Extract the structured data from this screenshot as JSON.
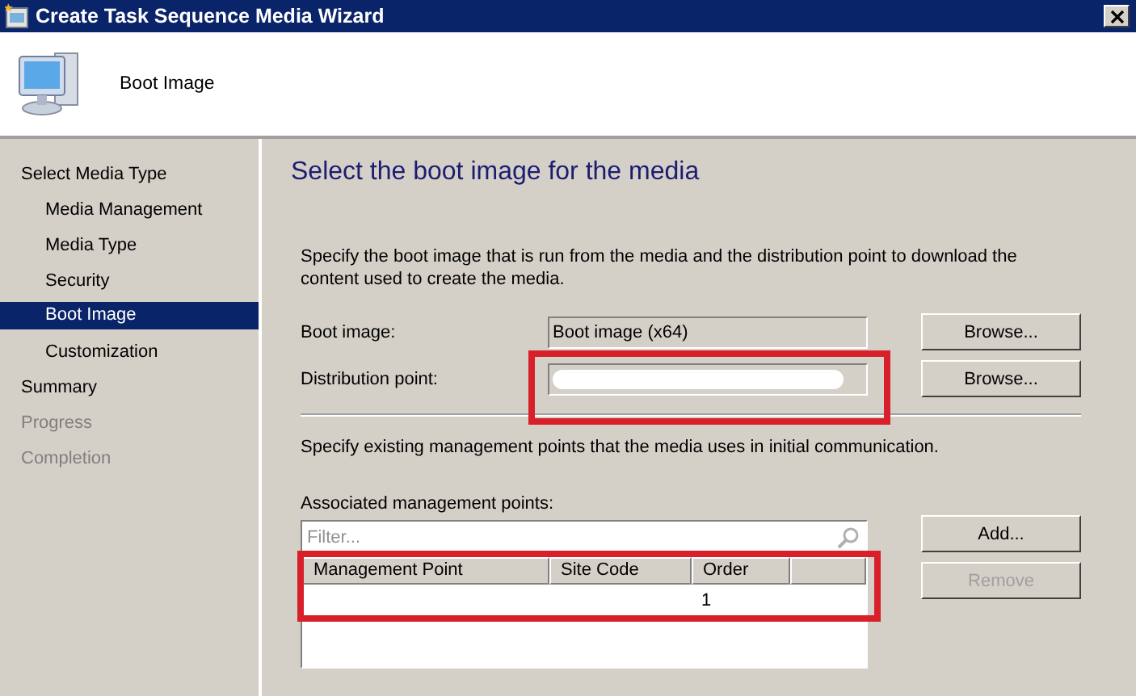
{
  "window": {
    "title": "Create Task Sequence Media Wizard"
  },
  "header": {
    "title": "Boot Image"
  },
  "steps": [
    {
      "label": "Select Media Type",
      "selected": false,
      "disabled": false,
      "children": [
        {
          "label": "Media Management",
          "selected": false,
          "disabled": false
        },
        {
          "label": "Media Type",
          "selected": false,
          "disabled": false
        },
        {
          "label": "Security",
          "selected": false,
          "disabled": false
        },
        {
          "label": "Boot Image",
          "selected": true,
          "disabled": false
        },
        {
          "label": "Customization",
          "selected": false,
          "disabled": false
        }
      ]
    },
    {
      "label": "Summary",
      "selected": false,
      "disabled": false
    },
    {
      "label": "Progress",
      "selected": false,
      "disabled": true
    },
    {
      "label": "Completion",
      "selected": false,
      "disabled": true
    }
  ],
  "page": {
    "heading": "Select the boot image for the media",
    "description": "Specify the boot image that is run from the media and the distribution point to download the content used to create the media.",
    "fields": [
      {
        "label": "Boot image:",
        "value": "Boot image (x64)",
        "redacted": false,
        "highlighted": false,
        "button": "Browse..."
      },
      {
        "label": "Distribution point:",
        "redacted": true,
        "highlighted": true,
        "button": "Browse..."
      }
    ],
    "mp_description": "Specify existing management points that the media uses in initial communication.",
    "list_label": "Associated management points:",
    "filter": {
      "placeholder": "Filter..."
    },
    "table": {
      "highlighted": true,
      "columns": [
        "Management Point",
        "Site Code",
        "Order"
      ],
      "rows": [
        {
          "order": "1"
        }
      ]
    },
    "buttons": [
      {
        "label": "Add...",
        "disabled": false
      },
      {
        "label": "Remove",
        "disabled": true
      }
    ]
  }
}
